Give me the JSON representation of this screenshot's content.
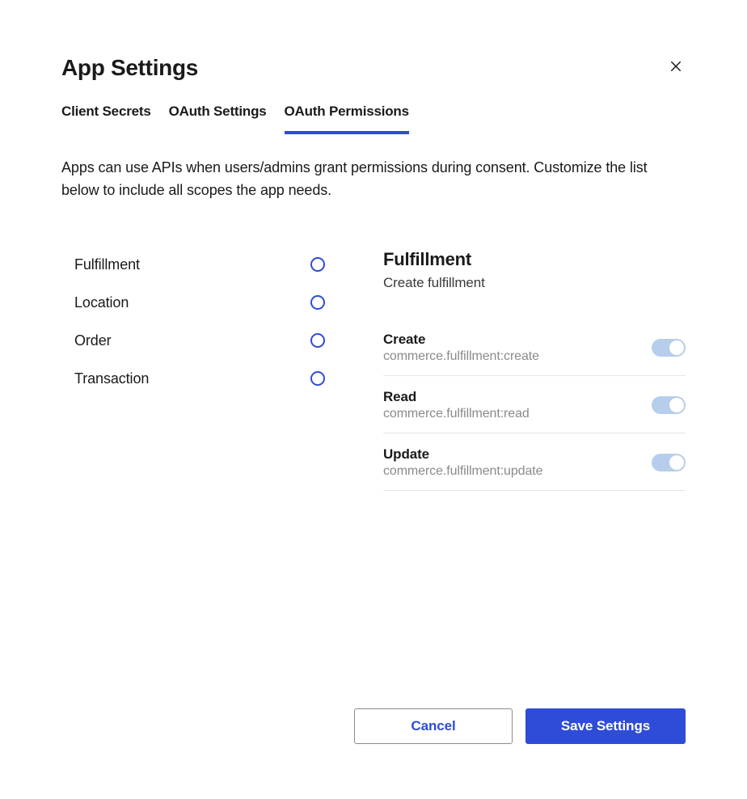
{
  "header": {
    "title": "App Settings"
  },
  "tabs": [
    {
      "label": "Client Secrets",
      "active": false
    },
    {
      "label": "OAuth Settings",
      "active": false
    },
    {
      "label": "OAuth Permissions",
      "active": true
    }
  ],
  "description": "Apps can use APIs when users/admins grant permissions during consent. Customize the list below to include all scopes the app needs.",
  "scopes": [
    {
      "label": "Fulfillment"
    },
    {
      "label": "Location"
    },
    {
      "label": "Order"
    },
    {
      "label": "Transaction"
    }
  ],
  "detail": {
    "title": "Fulfillment",
    "subtitle": "Create fulfillment"
  },
  "permissions": [
    {
      "name": "Create",
      "code": "commerce.fulfillment:create",
      "enabled": true
    },
    {
      "name": "Read",
      "code": "commerce.fulfillment:read",
      "enabled": true
    },
    {
      "name": "Update",
      "code": "commerce.fulfillment:update",
      "enabled": true
    }
  ],
  "footer": {
    "cancel": "Cancel",
    "save": "Save Settings"
  }
}
